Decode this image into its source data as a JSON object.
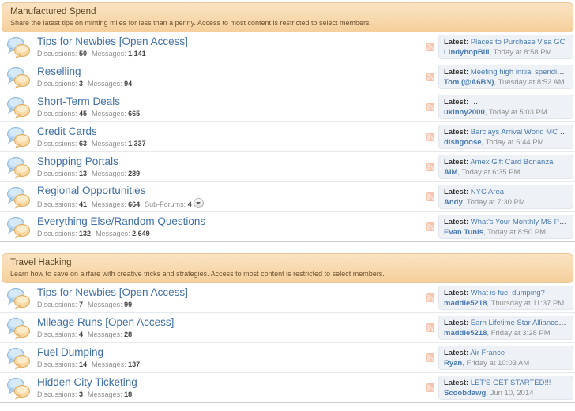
{
  "sections": [
    {
      "title": "Manufactured Spend",
      "description": "Share the latest tips on minting miles for less than a penny. Access to most content is restricted to select members.",
      "forums": [
        {
          "title": "Tips for Newbies [Open Access]",
          "discussions_label": "Discussions:",
          "discussions": "50",
          "messages_label": "Messages:",
          "messages": "1,141",
          "latest_label": "Latest:",
          "latest_title": "Places to Purchase Visa GC",
          "latest_user": "LindyhopBill",
          "latest_time": ", Today at 8:58 PM"
        },
        {
          "title": "Reselling",
          "discussions_label": "Discussions:",
          "discussions": "3",
          "messages_label": "Messages:",
          "messages": "94",
          "latest_label": "Latest:",
          "latest_title": "Meeting high initial spending for ...",
          "latest_user": "Tom (@A6BN)",
          "latest_time": ", Tuesday at 8:52 AM"
        },
        {
          "title": "Short-Term Deals",
          "discussions_label": "Discussions:",
          "discussions": "45",
          "messages_label": "Messages:",
          "messages": "665",
          "latest_label": "Latest:",
          "latest_title": "",
          "latest_redacted": true,
          "latest_user": "ukinny2000",
          "latest_time": ", Today at 5:03 PM"
        },
        {
          "title": "Credit Cards",
          "discussions_label": "Discussions:",
          "discussions": "63",
          "messages_label": "Messages:",
          "messages": "1,337",
          "latest_label": "Latest:",
          "latest_title": "Barclays Arrival World MC Credit L...",
          "latest_user": "dishgoose",
          "latest_time": ", Today at 5:44 PM"
        },
        {
          "title": "Shopping Portals",
          "discussions_label": "Discussions:",
          "discussions": "13",
          "messages_label": "Messages:",
          "messages": "289",
          "latest_label": "Latest:",
          "latest_title": "Amex Gift Card Bonanza",
          "latest_user": "AIM",
          "latest_time": ", Today at 6:35 PM"
        },
        {
          "title": "Regional Opportunities",
          "discussions_label": "Discussions:",
          "discussions": "41",
          "messages_label": "Messages:",
          "messages": "664",
          "subforums_label": "Sub-Forums:",
          "subforums": "4",
          "latest_label": "Latest:",
          "latest_title": "NYC Area",
          "latest_user": "Andy",
          "latest_time": ", Today at 7:30 PM"
        },
        {
          "title": "Everything Else/Random Questions",
          "discussions_label": "Discussions:",
          "discussions": "132",
          "messages_label": "Messages:",
          "messages": "2,649",
          "latest_label": "Latest:",
          "latest_title": "What's Your Monthly MS Pull?",
          "latest_user": "Evan Tunis",
          "latest_time": ", Today at 8:50 PM"
        }
      ]
    },
    {
      "title": "Travel Hacking",
      "description": "Learn how to save on airfare with creative tricks and strategies. Access to most content is restricted to select members.",
      "forums": [
        {
          "title": "Tips for Newbies [Open Access]",
          "discussions_label": "Discussions:",
          "discussions": "7",
          "messages_label": "Messages:",
          "messages": "99",
          "latest_label": "Latest:",
          "latest_title": "What is fuel dumping?",
          "latest_user": "maddie5218",
          "latest_time": ", Thursday at 11:37 PM"
        },
        {
          "title": "Mileage Runs [Open Access]",
          "discussions_label": "Discussions:",
          "discussions": "4",
          "messages_label": "Messages:",
          "messages": "28",
          "latest_label": "Latest:",
          "latest_title": "Earn Lifetime Star Alliance Gold S...",
          "latest_user": "maddie5218",
          "latest_time": ", Friday at 3:28 PM"
        },
        {
          "title": "Fuel Dumping",
          "discussions_label": "Discussions:",
          "discussions": "14",
          "messages_label": "Messages:",
          "messages": "137",
          "latest_label": "Latest:",
          "latest_title": "Air France",
          "latest_user": "Ryan",
          "latest_time": ", Friday at 10:03 AM"
        },
        {
          "title": "Hidden City Ticketing",
          "discussions_label": "Discussions:",
          "discussions": "3",
          "messages_label": "Messages:",
          "messages": "18",
          "latest_label": "Latest:",
          "latest_title": "LET'S GET STARTED!!!",
          "latest_user": "Scoobdawg",
          "latest_time": ", Jun 10, 2014"
        }
      ]
    }
  ],
  "icons": {
    "forum_icon": "speech-bubbles-icon",
    "feed_icon": "rss-feed-icon",
    "subforum_toggle_icon": "chevron-down-icon"
  },
  "colors": {
    "category_header_bg": "#f8d9ae",
    "category_header_border": "#e8c89a",
    "link": "#3f6fa8",
    "latest_box_bg": "#eef2f6",
    "rss_icon": "#f6c5b0"
  }
}
